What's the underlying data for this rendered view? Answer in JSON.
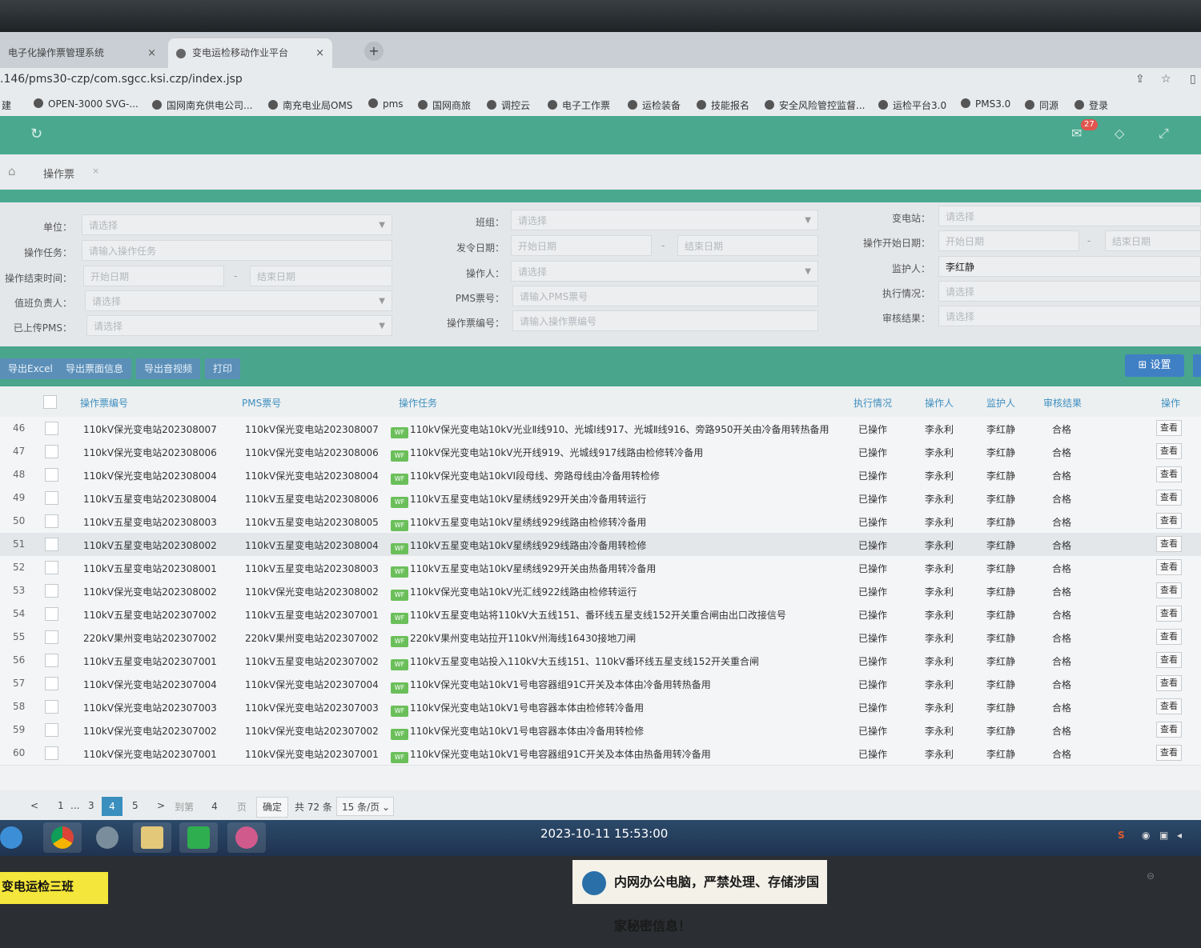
{
  "browser": {
    "tabs": [
      {
        "label": "电子化操作票管理系统",
        "close": "×"
      },
      {
        "label": "变电运检移动作业平台",
        "close": "×"
      }
    ],
    "new_tab": "+",
    "url": ".146/pms30-czp/com.sgcc.ksi.czp/index.jsp",
    "bookmarks": [
      "建",
      "OPEN-3000 SVG-...",
      "国网南充供电公司...",
      "南充电业局OMS",
      "pms",
      "国网商旅",
      "调控云",
      "电子工作票",
      "运检装备",
      "技能报名",
      "安全风险管控监督...",
      "运检平台3.0",
      "PMS3.0",
      "同源",
      "登录"
    ]
  },
  "header": {
    "notification_count": "27"
  },
  "breadcrumb": {
    "page": "操作票",
    "close": "×"
  },
  "filters": {
    "unit": {
      "label": "单位：",
      "placeholder": "请选择"
    },
    "team": {
      "label": "班组：",
      "placeholder": "请选择"
    },
    "substation": {
      "label": "变电站：",
      "placeholder": "请选择"
    },
    "task": {
      "label": "操作任务：",
      "placeholder": "请输入操作任务"
    },
    "issue_date": {
      "label": "发令日期：",
      "start": "开始日期",
      "end": "结束日期"
    },
    "op_start_date": {
      "label": "操作开始日期：",
      "start": "开始日期",
      "end": "结束日期"
    },
    "op_end_time": {
      "label": "操作结束时间：",
      "start": "开始日期",
      "end": "结束日期"
    },
    "operator": {
      "label": "操作人：",
      "placeholder": "请选择"
    },
    "guardian": {
      "label": "监护人：",
      "value": "李红静"
    },
    "duty_lead": {
      "label": "值班负责人：",
      "placeholder": "请选择"
    },
    "pms_no": {
      "label": "PMS票号：",
      "placeholder": "请输入PMS票号"
    },
    "exec_status": {
      "label": "执行情况：",
      "placeholder": "请选择"
    },
    "uploaded_pms": {
      "label": "已上传PMS：",
      "placeholder": "请选择"
    },
    "ticket_no": {
      "label": "操作票编号：",
      "placeholder": "请输入操作票编号"
    },
    "audit_result": {
      "label": "审核结果：",
      "placeholder": "请选择"
    },
    "dash": "-"
  },
  "toolbar": {
    "export_excel": "导出Excel",
    "export_face": "导出票面信息",
    "export_av": "导出音视频",
    "print": "打印",
    "settings": "设置"
  },
  "table": {
    "headers": {
      "ticket_no": "操作票编号",
      "pms_no": "PMS票号",
      "task": "操作任务",
      "status": "执行情况",
      "operator": "操作人",
      "guardian": "监护人",
      "audit": "审核结果",
      "action": "操作"
    },
    "rows": [
      {
        "num": "46",
        "ticket": "110kV保光变电站202308007",
        "pms": "110kV保光变电站202308007",
        "task": "110kV保光变电站10kV光业Ⅱ线910、光城Ⅰ线917、光城Ⅱ线916、旁路950开关由冷备用转热备用",
        "status": "已操作",
        "operator": "李永利",
        "guardian": "李红静",
        "audit": "合格",
        "action": "查看"
      },
      {
        "num": "47",
        "ticket": "110kV保光变电站202308006",
        "pms": "110kV保光变电站202308006",
        "task": "110kV保光变电站10kV光开线919、光城线917线路由检修转冷备用",
        "status": "已操作",
        "operator": "李永利",
        "guardian": "李红静",
        "audit": "合格",
        "action": "查看"
      },
      {
        "num": "48",
        "ticket": "110kV保光变电站202308004",
        "pms": "110kV保光变电站202308004",
        "task": "110kV保光变电站10kVⅠ段母线、旁路母线由冷备用转检修",
        "status": "已操作",
        "operator": "李永利",
        "guardian": "李红静",
        "audit": "合格",
        "action": "查看"
      },
      {
        "num": "49",
        "ticket": "110kV五星变电站202308004",
        "pms": "110kV五星变电站202308006",
        "task": "110kV五星变电站10kV星绣线929开关由冷备用转运行",
        "status": "已操作",
        "operator": "李永利",
        "guardian": "李红静",
        "audit": "合格",
        "action": "查看"
      },
      {
        "num": "50",
        "ticket": "110kV五星变电站202308003",
        "pms": "110kV五星变电站202308005",
        "task": "110kV五星变电站10kV星绣线929线路由检修转冷备用",
        "status": "已操作",
        "operator": "李永利",
        "guardian": "李红静",
        "audit": "合格",
        "action": "查看"
      },
      {
        "num": "51",
        "ticket": "110kV五星变电站202308002",
        "pms": "110kV五星变电站202308004",
        "task": "110kV五星变电站10kV星绣线929线路由冷备用转检修",
        "status": "已操作",
        "operator": "李永利",
        "guardian": "李红静",
        "audit": "合格",
        "action": "查看"
      },
      {
        "num": "52",
        "ticket": "110kV五星变电站202308001",
        "pms": "110kV五星变电站202308003",
        "task": "110kV五星变电站10kV星绣线929开关由热备用转冷备用",
        "status": "已操作",
        "operator": "李永利",
        "guardian": "李红静",
        "audit": "合格",
        "action": "查看"
      },
      {
        "num": "53",
        "ticket": "110kV保光变电站202308002",
        "pms": "110kV保光变电站202308002",
        "task": "110kV保光变电站10kV光汇线922线路由检修转运行",
        "status": "已操作",
        "operator": "李永利",
        "guardian": "李红静",
        "audit": "合格",
        "action": "查看"
      },
      {
        "num": "54",
        "ticket": "110kV五星变电站202307002",
        "pms": "110kV五星变电站202307001",
        "task": "110kV五星变电站将110kV大五线151、番环线五星支线152开关重合闸由出口改接信号",
        "status": "已操作",
        "operator": "李永利",
        "guardian": "李红静",
        "audit": "合格",
        "action": "查看"
      },
      {
        "num": "55",
        "ticket": "220kV果州变电站202307002",
        "pms": "220kV果州变电站202307002",
        "task": "220kV果州变电站拉开110kV州海线16430接地刀闸",
        "status": "已操作",
        "operator": "李永利",
        "guardian": "李红静",
        "audit": "合格",
        "action": "查看"
      },
      {
        "num": "56",
        "ticket": "110kV五星变电站202307001",
        "pms": "110kV五星变电站202307002",
        "task": "110kV五星变电站投入110kV大五线151、110kV番环线五星支线152开关重合闸",
        "status": "已操作",
        "operator": "李永利",
        "guardian": "李红静",
        "audit": "合格",
        "action": "查看"
      },
      {
        "num": "57",
        "ticket": "110kV保光变电站202307004",
        "pms": "110kV保光变电站202307004",
        "task": "110kV保光变电站10kV1号电容器组91C开关及本体由冷备用转热备用",
        "status": "已操作",
        "operator": "李永利",
        "guardian": "李红静",
        "audit": "合格",
        "action": "查看"
      },
      {
        "num": "58",
        "ticket": "110kV保光变电站202307003",
        "pms": "110kV保光变电站202307003",
        "task": "110kV保光变电站10kV1号电容器本体由检修转冷备用",
        "status": "已操作",
        "operator": "李永利",
        "guardian": "李红静",
        "audit": "合格",
        "action": "查看"
      },
      {
        "num": "59",
        "ticket": "110kV保光变电站202307002",
        "pms": "110kV保光变电站202307002",
        "task": "110kV保光变电站10kV1号电容器本体由冷备用转检修",
        "status": "已操作",
        "operator": "李永利",
        "guardian": "李红静",
        "audit": "合格",
        "action": "查看"
      },
      {
        "num": "60",
        "ticket": "110kV保光变电站202307001",
        "pms": "110kV保光变电站202307001",
        "task": "110kV保光变电站10kV1号电容器组91C开关及本体由热备用转冷备用",
        "status": "已操作",
        "operator": "李永利",
        "guardian": "李红静",
        "audit": "合格",
        "action": "查看"
      }
    ]
  },
  "pagination": {
    "prev": "<",
    "p1": "1",
    "ellipsis": "...",
    "p3": "3",
    "current": "4",
    "p5": "5",
    "next": ">",
    "goto_label": "到第",
    "goto_value": "4",
    "page_unit": "页",
    "confirm": "确定",
    "total": "共 72 条",
    "per_page": "15 条/页"
  },
  "taskbar": {
    "clock": "2023-10-11 15:53:00"
  },
  "stickers": {
    "team": "变电运检三班",
    "warning": "内网办公电脑，严禁处理、存储涉国家秘密信息！"
  }
}
